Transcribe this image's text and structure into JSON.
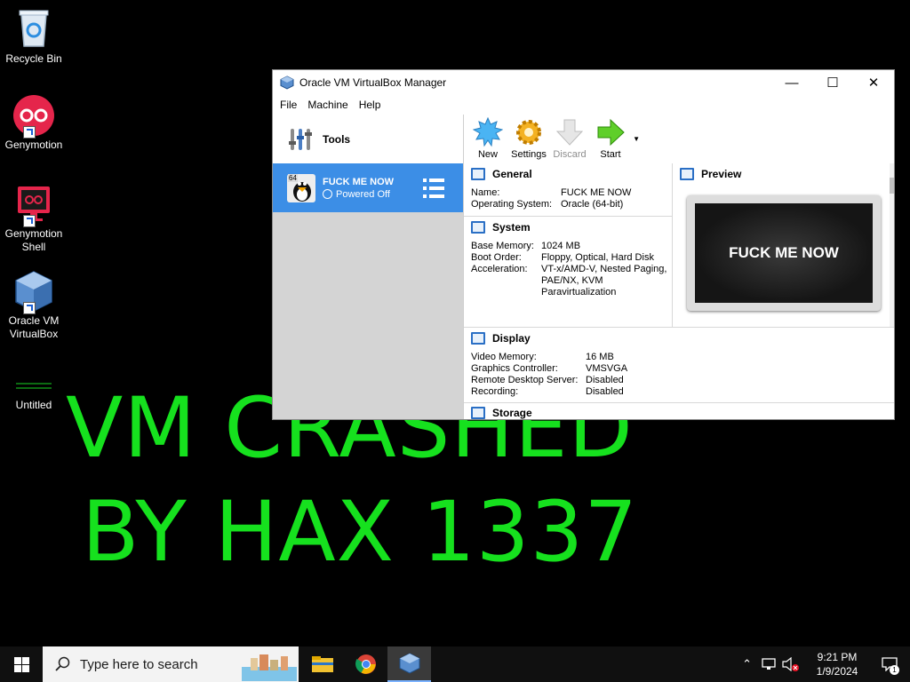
{
  "desktop": {
    "icons": [
      {
        "label": "Recycle Bin",
        "icon": "recycle-bin-icon"
      },
      {
        "label": "Genymotion",
        "icon": "genymotion-icon"
      },
      {
        "label": "Genymotion\nShell",
        "icon": "genymotion-shell-icon"
      },
      {
        "label": "Oracle VM\nVirtualBox",
        "icon": "virtualbox-icon"
      },
      {
        "label": "Untitled",
        "icon": "file-icon"
      }
    ],
    "big_text_line1": "VM CRASHED",
    "big_text_line2": "BY HAX 1337"
  },
  "window": {
    "title": "Oracle VM VirtualBox Manager",
    "menu": [
      "File",
      "Machine",
      "Help"
    ],
    "tools_label": "Tools",
    "vm": {
      "name": "FUCK ME NOW",
      "state": "Powered Off",
      "badge": "64"
    },
    "toolbar": [
      {
        "label": "New",
        "icon": "new-icon",
        "enabled": true
      },
      {
        "label": "Settings",
        "icon": "settings-gear-icon",
        "enabled": true
      },
      {
        "label": "Discard",
        "icon": "discard-arrow-icon",
        "enabled": false
      },
      {
        "label": "Start",
        "icon": "start-arrow-icon",
        "enabled": true
      }
    ],
    "general": {
      "title": "General",
      "rows": [
        {
          "k": "Name:",
          "v": "FUCK ME NOW"
        },
        {
          "k": "Operating System:",
          "v": "Oracle (64-bit)"
        }
      ]
    },
    "system": {
      "title": "System",
      "rows": [
        {
          "k": "Base Memory:",
          "v": "1024 MB"
        },
        {
          "k": "Boot Order:",
          "v": "Floppy, Optical, Hard Disk"
        },
        {
          "k": "Acceleration:",
          "v": "VT-x/AMD-V, Nested Paging,"
        },
        {
          "k": "",
          "v": "PAE/NX, KVM"
        },
        {
          "k": "",
          "v": "Paravirtualization"
        }
      ]
    },
    "preview": {
      "title": "Preview",
      "screen_text": "FUCK ME NOW"
    },
    "display": {
      "title": "Display",
      "rows": [
        {
          "k": "Video Memory:",
          "v": "16 MB"
        },
        {
          "k": "Graphics Controller:",
          "v": "VMSVGA"
        },
        {
          "k": "Remote Desktop Server:",
          "v": "Disabled"
        },
        {
          "k": "Recording:",
          "v": "Disabled"
        }
      ]
    },
    "storage": {
      "title": "Storage"
    }
  },
  "taskbar": {
    "search_placeholder": "Type here to search",
    "time": "9:21 PM",
    "date": "1/9/2024",
    "notification_count": "1"
  }
}
